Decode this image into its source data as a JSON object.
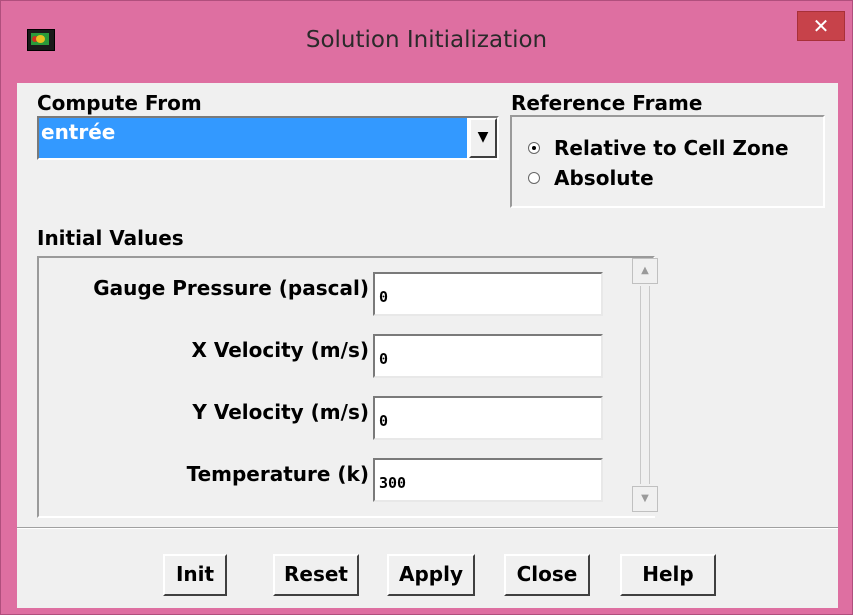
{
  "window": {
    "title": "Solution Initialization",
    "close_glyph": "✕"
  },
  "compute_from": {
    "label": "Compute From",
    "selected": "entrée",
    "dropdown_glyph": "▼"
  },
  "reference_frame": {
    "label": "Reference Frame",
    "options": [
      {
        "label": "Relative to Cell Zone",
        "checked": true
      },
      {
        "label": "Absolute",
        "checked": false
      }
    ]
  },
  "initial_values": {
    "label": "Initial Values",
    "fields": [
      {
        "label": "Gauge Pressure (pascal)",
        "value": "0"
      },
      {
        "label": "X Velocity (m/s)",
        "value": "0"
      },
      {
        "label": "Y Velocity (m/s)",
        "value": "0"
      },
      {
        "label": "Temperature (k)",
        "value": "300"
      }
    ]
  },
  "buttons": {
    "init": "Init",
    "reset": "Reset",
    "apply": "Apply",
    "close": "Close",
    "help": "Help"
  },
  "icons": {
    "app": "fluent-app-icon",
    "scroll_up": "scroll-up-arrow-icon",
    "scroll_down": "scroll-down-arrow-icon"
  }
}
